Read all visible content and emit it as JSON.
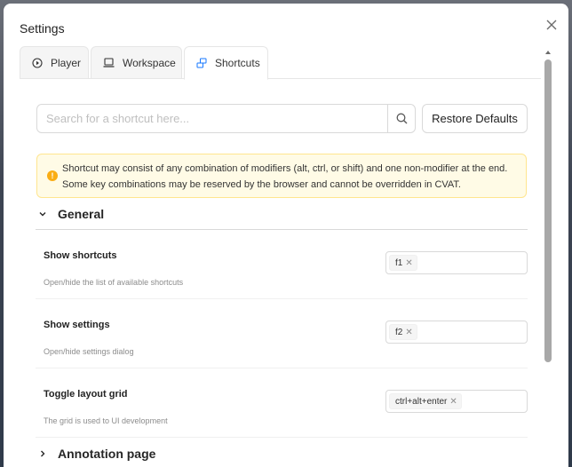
{
  "modal": {
    "title": "Settings",
    "close_icon": "close-icon"
  },
  "tabs": [
    {
      "label": "Player",
      "icon": "play-circle-icon",
      "active": false
    },
    {
      "label": "Workspace",
      "icon": "laptop-icon",
      "active": false
    },
    {
      "label": "Shortcuts",
      "icon": "shortcut-keys-icon",
      "active": true
    }
  ],
  "search": {
    "placeholder": "Search for a shortcut here...",
    "value": "",
    "icon": "search-icon"
  },
  "restore_button": "Restore Defaults",
  "alert": {
    "icon": "exclamation-icon",
    "text": "Shortcut may consist of any combination of modifiers (alt, ctrl, or shift) and one non-modifier at the end. Some key combinations may be reserved by the browser and cannot be overridden in CVAT."
  },
  "groups": [
    {
      "title": "General",
      "expanded": true,
      "items": [
        {
          "name": "Show shortcuts",
          "description": "Open/hide the list of available shortcuts",
          "keys": "f1"
        },
        {
          "name": "Show settings",
          "description": "Open/hide settings dialog",
          "keys": "f2"
        },
        {
          "name": "Toggle layout grid",
          "description": "The grid is used to UI development",
          "keys": "ctrl+alt+enter"
        }
      ]
    },
    {
      "title": "Annotation page",
      "expanded": false,
      "items": []
    }
  ],
  "colors": {
    "alert_bg": "#fffbe6",
    "alert_border": "#ffe58f",
    "warning_icon": "#faad14",
    "accent_blue": "#1677ff"
  }
}
